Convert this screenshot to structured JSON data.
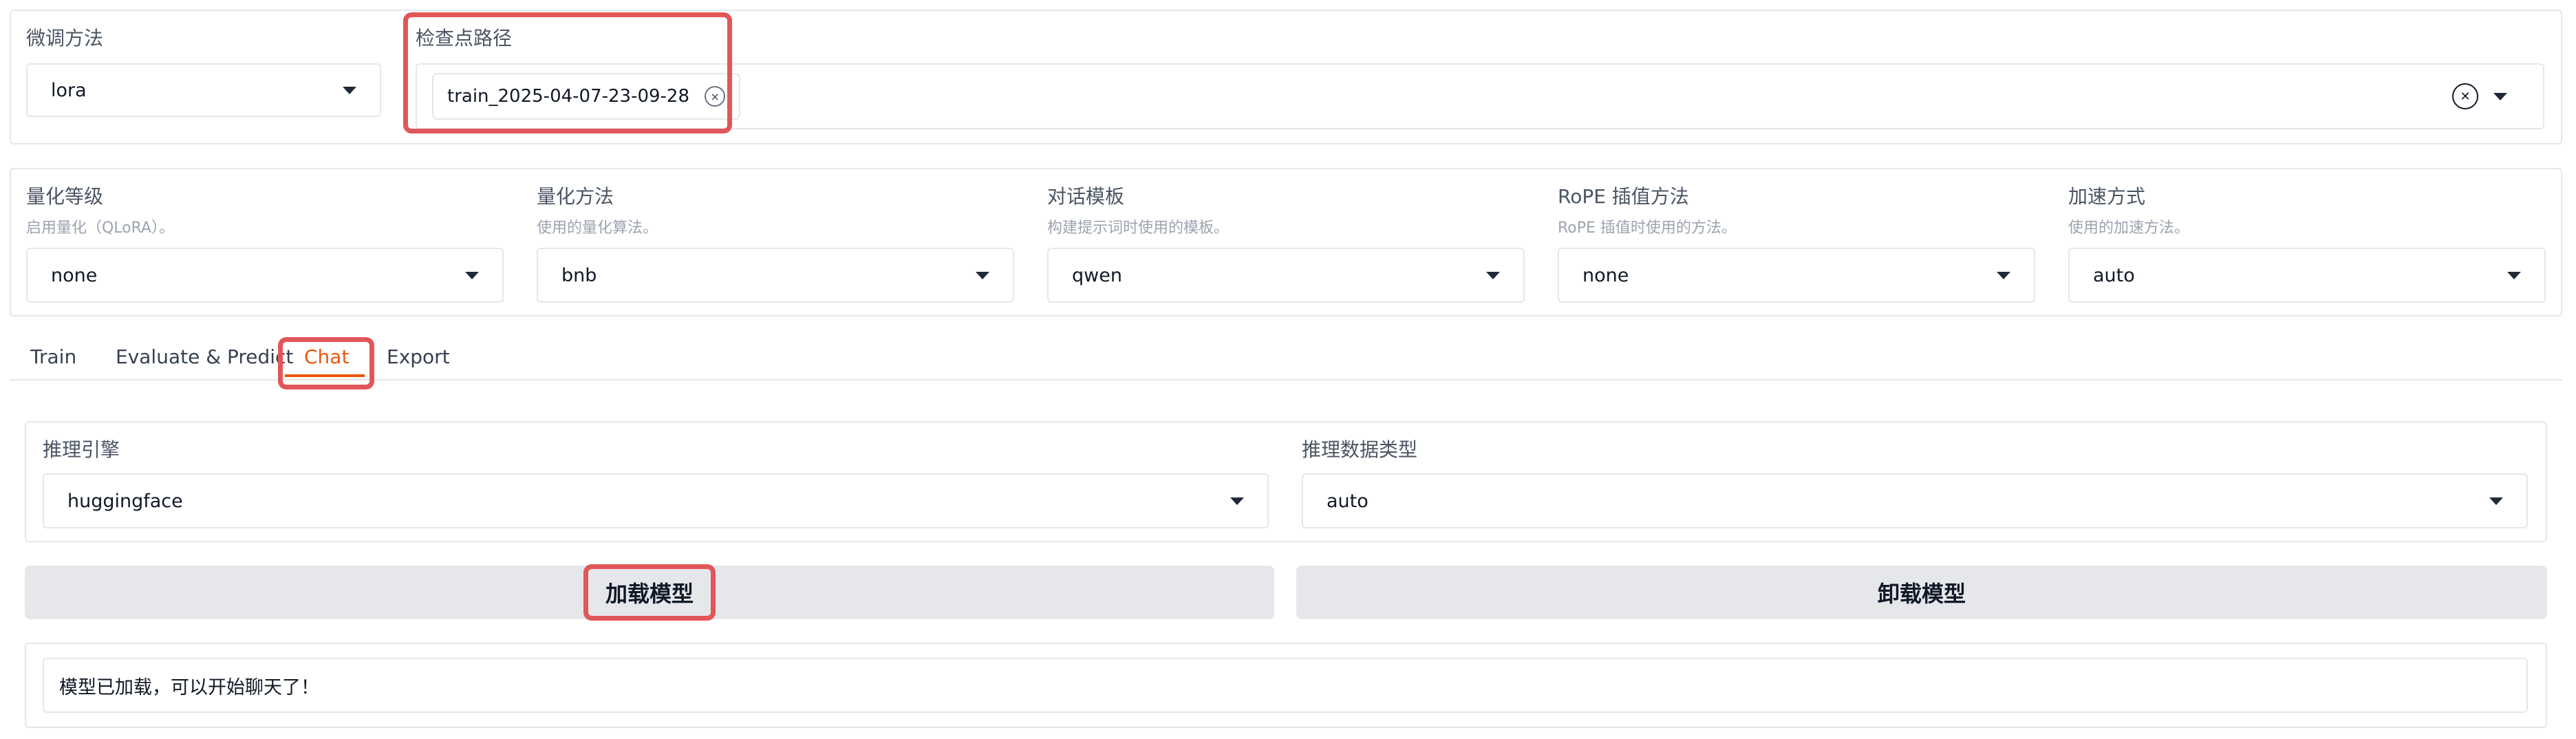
{
  "top": {
    "finetune_method": {
      "label": "微调方法",
      "value": "lora"
    },
    "checkpoint": {
      "label": "检查点路径",
      "chip": "train_2025-04-07-23-09-28",
      "chip_remove": "×",
      "clear": "✕"
    }
  },
  "quant_row": [
    {
      "label": "量化等级",
      "hint": "启用量化（QLoRA）。",
      "value": "none"
    },
    {
      "label": "量化方法",
      "hint": "使用的量化算法。",
      "value": "bnb"
    },
    {
      "label": "对话模板",
      "hint": "构建提示词时使用的模板。",
      "value": "qwen"
    },
    {
      "label": "RoPE 插值方法",
      "hint": "RoPE 插值时使用的方法。",
      "value": "none"
    },
    {
      "label": "加速方式",
      "hint": "使用的加速方法。",
      "value": "auto"
    }
  ],
  "tabs": [
    "Train",
    "Evaluate & Predict",
    "Chat",
    "Export"
  ],
  "active_tab": "Chat",
  "chat": {
    "infer_backend": {
      "label": "推理引擎",
      "value": "huggingface"
    },
    "infer_dtype": {
      "label": "推理数据类型",
      "value": "auto"
    },
    "load_button": "加载模型",
    "unload_button": "卸载模型",
    "info_box": "模型已加载，可以开始聊天了！"
  },
  "colors": {
    "accent": "#ea580c",
    "highlight": "#e15759"
  }
}
